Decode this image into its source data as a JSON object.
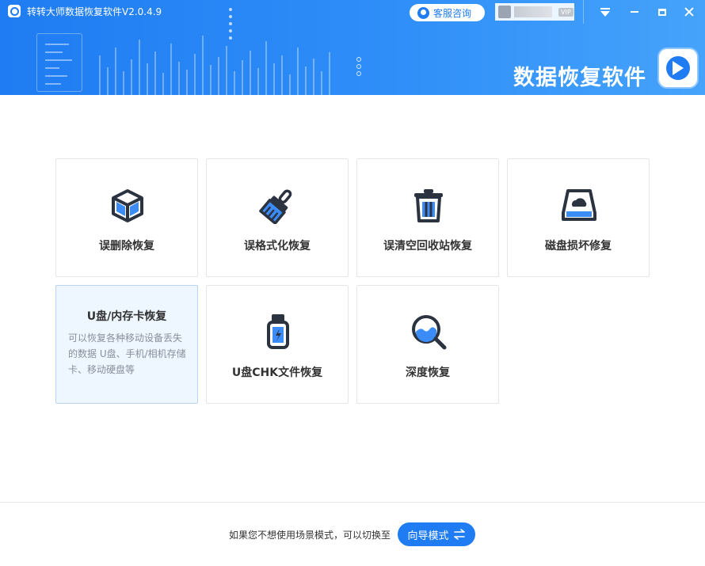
{
  "window": {
    "title": "转转大师数据恢复软件V2.0.4.9",
    "service_label": "客服咨询",
    "vip_label": "VIP",
    "brand_text": "数据恢复软件"
  },
  "modes": [
    {
      "label": "误删除恢复",
      "icon": "cube-icon"
    },
    {
      "label": "误格式化恢复",
      "icon": "broom-icon"
    },
    {
      "label": "误清空回收站恢复",
      "icon": "trash-icon"
    },
    {
      "label": "磁盘损坏修复",
      "icon": "disk-icon"
    },
    {
      "label": "U盘/内存卡恢复",
      "desc": "可以恢复各种移动设备丢失的数据 U盘、手机/相机存储卡、移动硬盘等",
      "selected": true
    },
    {
      "label": "U盘CHK文件恢复",
      "icon": "usb-icon"
    },
    {
      "label": "深度恢复",
      "icon": "magnifier-icon"
    }
  ],
  "footer": {
    "hint": "如果您不想使用场景模式，可以切换至",
    "guide_button": "向导模式"
  },
  "colors": {
    "accent": "#1f7cf2",
    "icon_dark": "#2b3340"
  }
}
